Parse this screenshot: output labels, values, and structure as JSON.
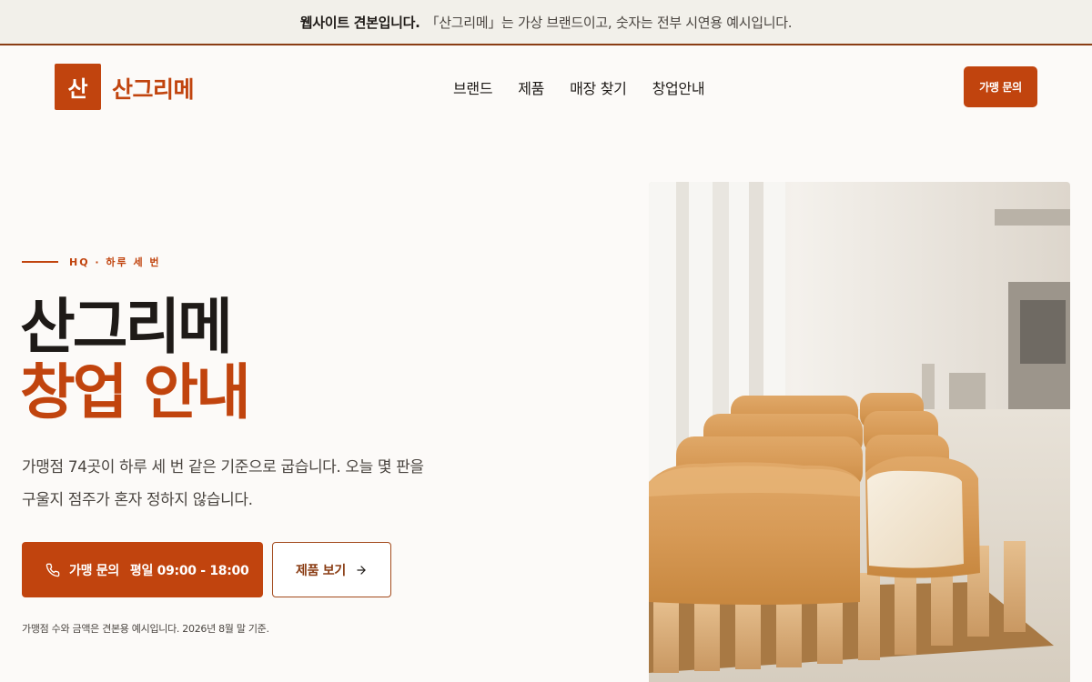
{
  "notice": {
    "strong": "웹사이트 견본입니다.",
    "text": "「산그리메」는 가상 브랜드이고, 숫자는 전부 시연용 예시입니다."
  },
  "header": {
    "logo_mark": "산",
    "logo_text": "산그리메",
    "nav": [
      "브랜드",
      "제품",
      "매장 찾기",
      "창업안내"
    ],
    "cta": "가맹 문의"
  },
  "hero": {
    "eyebrow": "HQ · 하루 세 번",
    "title_line1": "산그리메",
    "title_line2": "창업 안내",
    "desc_line1": "가맹점 74곳이 하루 세 번 같은 기준으로 굽습니다. 오늘 몇 판을",
    "desc_line2": "구울지 점주가 혼자 정하지 않습니다.",
    "primary_label": "가맹 문의",
    "primary_hours": "평일 09:00 - 18:00",
    "secondary_label": "제품 보기",
    "footnote": "가맹점 수와 금액은 견본용 예시입니다. 2026년 8월 말 기준."
  },
  "icons": {
    "primary": "phone-icon",
    "secondary": "arrow-right-icon"
  },
  "colors": {
    "accent": "#c1440e",
    "accent_dark": "#8a3d14",
    "background": "#fcfaf8",
    "notice_bg": "#f2f0ea",
    "text": "#1e1a17"
  }
}
